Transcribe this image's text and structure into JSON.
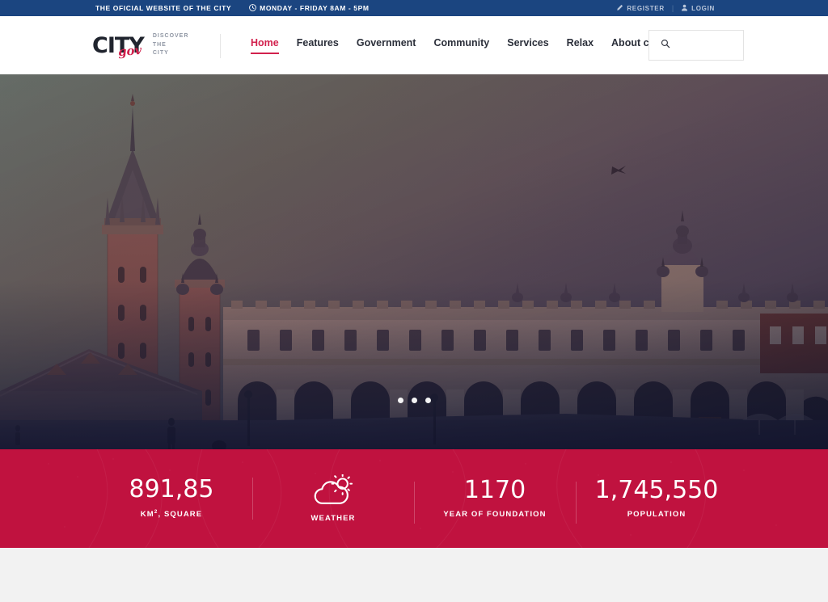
{
  "topbar": {
    "tagline": "THE OFICIAL WEBSITE OF THE CITY",
    "hours": "MONDAY - FRIDAY 8AM - 5PM",
    "clock_icon": "clock-icon",
    "register_label": "REGISTER",
    "register_icon": "pencil-icon",
    "login_label": "LOGIN",
    "login_icon": "user-icon",
    "separator": "|",
    "bg_color": "#1b4580"
  },
  "header": {
    "logo": {
      "word": "CITY",
      "script": "gov",
      "tagline_lines": [
        "DISCOVER",
        "THE",
        "CITY"
      ],
      "script_color": "#cf1f4b",
      "word_color": "#20242e"
    },
    "nav": [
      {
        "label": "Home",
        "active": true
      },
      {
        "label": "Features",
        "active": false
      },
      {
        "label": "Government",
        "active": false
      },
      {
        "label": "Community",
        "active": false
      },
      {
        "label": "Services",
        "active": false
      },
      {
        "label": "Relax",
        "active": false
      },
      {
        "label": "About city",
        "active": false
      }
    ],
    "accent_color": "#d2214d",
    "search": {
      "icon": "search-icon",
      "value": "",
      "placeholder": ""
    }
  },
  "hero": {
    "scene": "historic city market square with gothic basilica and arcaded cloth hall at dusk",
    "carousel_dots": 3,
    "active_dot": 0
  },
  "stats": {
    "bg_color": "#c0123f",
    "items": [
      {
        "value": "891,85",
        "label": "KM2, SQUARE",
        "label_prefix": "KM",
        "label_sup": "2",
        "label_suffix": ", SQUARE",
        "icon": null
      },
      {
        "value": "",
        "label": "WEATHER",
        "icon": "weather-cloud-sun-icon"
      },
      {
        "value": "1170",
        "label": "YEAR OF FOUNDATION",
        "icon": null
      },
      {
        "value": "1,745,550",
        "label": "POPULATION",
        "icon": null
      }
    ]
  }
}
